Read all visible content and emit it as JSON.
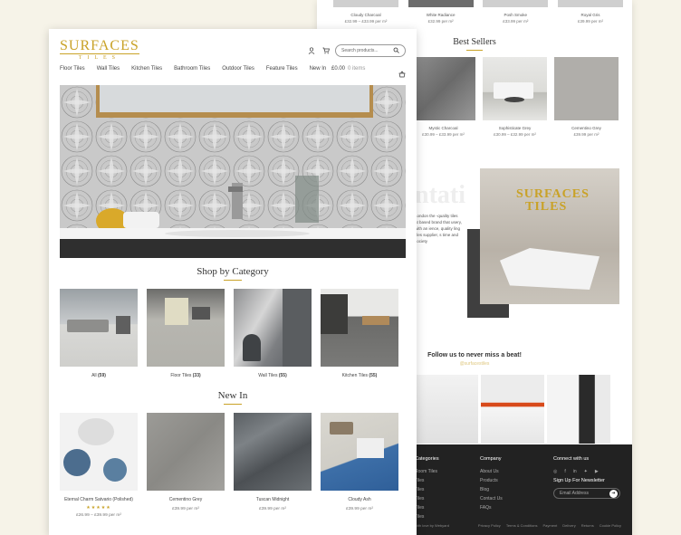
{
  "back": {
    "top_products": [
      {
        "name": "Cloudy Charcoal",
        "price": "£32.99 – £33.99 per m²"
      },
      {
        "name": "White Radiance",
        "price": "£32.99 per m²"
      },
      {
        "name": "Posh Smoke",
        "price": "£33.99 per m²"
      },
      {
        "name": "Royal Gris",
        "price": "£39.99 per m²"
      }
    ],
    "best_sellers_title": "Best Sellers",
    "best_sellers": [
      {
        "name": "Mystic Charcoal",
        "price": "£30.99 – £33.99 per m²"
      },
      {
        "name": "Sophisticate Grey",
        "price": "£30.99 – £32.99 per m²"
      },
      {
        "name": "Cementino Grey",
        "price": "£39.99 per m²"
      }
    ],
    "watermark": "ntati",
    "about_text": "London the -quality tiles at based brand that usery, with an ience, quality ling tiles supplier, s time and society",
    "brand_sign_1": "SURFACES",
    "brand_sign_2": "TILES",
    "follow_title": "Follow us to never miss a beat!",
    "handle": "@surfacestiles",
    "footer": {
      "categories_title": "Categories",
      "categories": [
        "Room Tiles",
        "Tiles",
        "Tiles",
        "Tiles",
        "Tiles",
        "Tiles"
      ],
      "company_title": "Company",
      "company": [
        "About Us",
        "Products",
        "Blog",
        "Contact Us",
        "FAQs"
      ],
      "connect_title": "Connect with us",
      "signup_title": "Sign Up For Newsletter",
      "email_placeholder": "Email Address",
      "credit": "with love by Webyard",
      "legal": [
        "Privacy Policy",
        "Terms & Conditions",
        "Payment",
        "Delivery",
        "Returns",
        "Cookie Policy"
      ]
    }
  },
  "front": {
    "logo_line1": "SURFACES",
    "logo_line2": "TILES",
    "search_placeholder": "Search products...",
    "nav": [
      "Floor Tiles",
      "Wall Tiles",
      "Kitchen Tiles",
      "Bathroom Tiles",
      "Outdoor Tiles",
      "Feature Tiles",
      "New In"
    ],
    "cart_total": "£0.00",
    "cart_items": "0 items",
    "shop_title": "Shop by Category",
    "categories": [
      {
        "label": "All",
        "count": "(59)"
      },
      {
        "label": "Floor Tiles",
        "count": "(33)"
      },
      {
        "label": "Wall Tiles",
        "count": "(55)"
      },
      {
        "label": "Kitchen Tiles",
        "count": "(55)"
      }
    ],
    "new_title": "New In",
    "new_in": [
      {
        "name": "Eternal Charm Satvario (Polished)",
        "price": "£26.99 – £39.99 per m²",
        "stars": "★★★★★"
      },
      {
        "name": "Cementino Grey",
        "price": "£39.99 per m²",
        "stars": ""
      },
      {
        "name": "Tuscan Midnight",
        "price": "£39.99 per m²",
        "stars": ""
      },
      {
        "name": "Cloudy Ash",
        "price": "£39.99 per m²",
        "stars": ""
      }
    ]
  },
  "colors": {
    "gold": "#c9a227",
    "footer_bg": "#222222",
    "page_bg": "#f6f3e8"
  }
}
